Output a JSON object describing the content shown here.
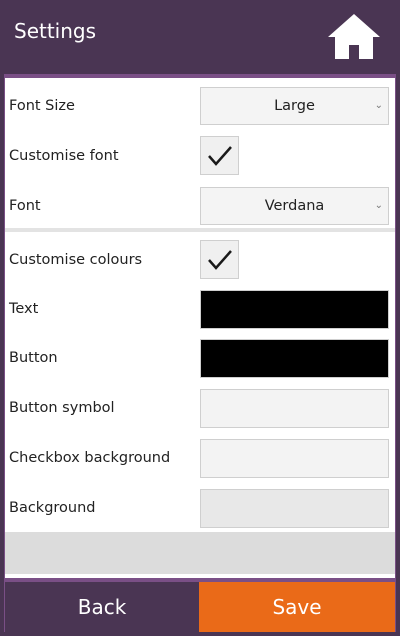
{
  "header": {
    "title": "Settings",
    "home_icon": "home-icon"
  },
  "settings": {
    "font_size": {
      "label": "Font Size",
      "value": "Large"
    },
    "customise_font": {
      "label": "Customise font",
      "checked": true
    },
    "font": {
      "label": "Font",
      "value": "Verdana"
    },
    "customise_colours": {
      "label": "Customise colours",
      "checked": true
    },
    "text_colour": {
      "label": "Text",
      "color": "#000000"
    },
    "button_colour": {
      "label": "Button",
      "color": "#000000"
    },
    "button_symbol_colour": {
      "label": "Button symbol",
      "color": "#f3f3f3"
    },
    "checkbox_background_colour": {
      "label": "Checkbox background",
      "color": "#f3f3f3"
    },
    "background_colour": {
      "label": "Background",
      "color": "#e8e8e8"
    }
  },
  "footer": {
    "back_label": "Back",
    "save_label": "Save"
  },
  "colors": {
    "header_bg": "#4a3553",
    "frame": "#7a4f86",
    "save_accent": "#ea6a18"
  }
}
